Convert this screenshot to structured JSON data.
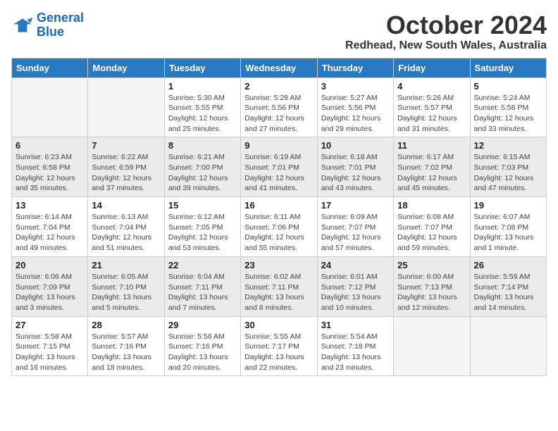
{
  "header": {
    "logo_line1": "General",
    "logo_line2": "Blue",
    "title": "October 2024",
    "location": "Redhead, New South Wales, Australia"
  },
  "weekdays": [
    "Sunday",
    "Monday",
    "Tuesday",
    "Wednesday",
    "Thursday",
    "Friday",
    "Saturday"
  ],
  "weeks": [
    [
      {
        "day": "",
        "sunrise": "",
        "sunset": "",
        "daylight": "",
        "empty": true
      },
      {
        "day": "",
        "sunrise": "",
        "sunset": "",
        "daylight": "",
        "empty": true
      },
      {
        "day": "1",
        "sunrise": "Sunrise: 5:30 AM",
        "sunset": "Sunset: 5:55 PM",
        "daylight": "Daylight: 12 hours and 25 minutes."
      },
      {
        "day": "2",
        "sunrise": "Sunrise: 5:28 AM",
        "sunset": "Sunset: 5:56 PM",
        "daylight": "Daylight: 12 hours and 27 minutes."
      },
      {
        "day": "3",
        "sunrise": "Sunrise: 5:27 AM",
        "sunset": "Sunset: 5:56 PM",
        "daylight": "Daylight: 12 hours and 29 minutes."
      },
      {
        "day": "4",
        "sunrise": "Sunrise: 5:26 AM",
        "sunset": "Sunset: 5:57 PM",
        "daylight": "Daylight: 12 hours and 31 minutes."
      },
      {
        "day": "5",
        "sunrise": "Sunrise: 5:24 AM",
        "sunset": "Sunset: 5:58 PM",
        "daylight": "Daylight: 12 hours and 33 minutes."
      }
    ],
    [
      {
        "day": "6",
        "sunrise": "Sunrise: 6:23 AM",
        "sunset": "Sunset: 6:58 PM",
        "daylight": "Daylight: 12 hours and 35 minutes."
      },
      {
        "day": "7",
        "sunrise": "Sunrise: 6:22 AM",
        "sunset": "Sunset: 6:59 PM",
        "daylight": "Daylight: 12 hours and 37 minutes."
      },
      {
        "day": "8",
        "sunrise": "Sunrise: 6:21 AM",
        "sunset": "Sunset: 7:00 PM",
        "daylight": "Daylight: 12 hours and 39 minutes."
      },
      {
        "day": "9",
        "sunrise": "Sunrise: 6:19 AM",
        "sunset": "Sunset: 7:01 PM",
        "daylight": "Daylight: 12 hours and 41 minutes."
      },
      {
        "day": "10",
        "sunrise": "Sunrise: 6:18 AM",
        "sunset": "Sunset: 7:01 PM",
        "daylight": "Daylight: 12 hours and 43 minutes."
      },
      {
        "day": "11",
        "sunrise": "Sunrise: 6:17 AM",
        "sunset": "Sunset: 7:02 PM",
        "daylight": "Daylight: 12 hours and 45 minutes."
      },
      {
        "day": "12",
        "sunrise": "Sunrise: 6:15 AM",
        "sunset": "Sunset: 7:03 PM",
        "daylight": "Daylight: 12 hours and 47 minutes."
      }
    ],
    [
      {
        "day": "13",
        "sunrise": "Sunrise: 6:14 AM",
        "sunset": "Sunset: 7:04 PM",
        "daylight": "Daylight: 12 hours and 49 minutes."
      },
      {
        "day": "14",
        "sunrise": "Sunrise: 6:13 AM",
        "sunset": "Sunset: 7:04 PM",
        "daylight": "Daylight: 12 hours and 51 minutes."
      },
      {
        "day": "15",
        "sunrise": "Sunrise: 6:12 AM",
        "sunset": "Sunset: 7:05 PM",
        "daylight": "Daylight: 12 hours and 53 minutes."
      },
      {
        "day": "16",
        "sunrise": "Sunrise: 6:11 AM",
        "sunset": "Sunset: 7:06 PM",
        "daylight": "Daylight: 12 hours and 55 minutes."
      },
      {
        "day": "17",
        "sunrise": "Sunrise: 6:09 AM",
        "sunset": "Sunset: 7:07 PM",
        "daylight": "Daylight: 12 hours and 57 minutes."
      },
      {
        "day": "18",
        "sunrise": "Sunrise: 6:08 AM",
        "sunset": "Sunset: 7:07 PM",
        "daylight": "Daylight: 12 hours and 59 minutes."
      },
      {
        "day": "19",
        "sunrise": "Sunrise: 6:07 AM",
        "sunset": "Sunset: 7:08 PM",
        "daylight": "Daylight: 13 hours and 1 minute."
      }
    ],
    [
      {
        "day": "20",
        "sunrise": "Sunrise: 6:06 AM",
        "sunset": "Sunset: 7:09 PM",
        "daylight": "Daylight: 13 hours and 3 minutes."
      },
      {
        "day": "21",
        "sunrise": "Sunrise: 6:05 AM",
        "sunset": "Sunset: 7:10 PM",
        "daylight": "Daylight: 13 hours and 5 minutes."
      },
      {
        "day": "22",
        "sunrise": "Sunrise: 6:04 AM",
        "sunset": "Sunset: 7:11 PM",
        "daylight": "Daylight: 13 hours and 7 minutes."
      },
      {
        "day": "23",
        "sunrise": "Sunrise: 6:02 AM",
        "sunset": "Sunset: 7:11 PM",
        "daylight": "Daylight: 13 hours and 8 minutes."
      },
      {
        "day": "24",
        "sunrise": "Sunrise: 6:01 AM",
        "sunset": "Sunset: 7:12 PM",
        "daylight": "Daylight: 13 hours and 10 minutes."
      },
      {
        "day": "25",
        "sunrise": "Sunrise: 6:00 AM",
        "sunset": "Sunset: 7:13 PM",
        "daylight": "Daylight: 13 hours and 12 minutes."
      },
      {
        "day": "26",
        "sunrise": "Sunrise: 5:59 AM",
        "sunset": "Sunset: 7:14 PM",
        "daylight": "Daylight: 13 hours and 14 minutes."
      }
    ],
    [
      {
        "day": "27",
        "sunrise": "Sunrise: 5:58 AM",
        "sunset": "Sunset: 7:15 PM",
        "daylight": "Daylight: 13 hours and 16 minutes."
      },
      {
        "day": "28",
        "sunrise": "Sunrise: 5:57 AM",
        "sunset": "Sunset: 7:16 PM",
        "daylight": "Daylight: 13 hours and 18 minutes."
      },
      {
        "day": "29",
        "sunrise": "Sunrise: 5:56 AM",
        "sunset": "Sunset: 7:16 PM",
        "daylight": "Daylight: 13 hours and 20 minutes."
      },
      {
        "day": "30",
        "sunrise": "Sunrise: 5:55 AM",
        "sunset": "Sunset: 7:17 PM",
        "daylight": "Daylight: 13 hours and 22 minutes."
      },
      {
        "day": "31",
        "sunrise": "Sunrise: 5:54 AM",
        "sunset": "Sunset: 7:18 PM",
        "daylight": "Daylight: 13 hours and 23 minutes."
      },
      {
        "day": "",
        "sunrise": "",
        "sunset": "",
        "daylight": "",
        "empty": true
      },
      {
        "day": "",
        "sunrise": "",
        "sunset": "",
        "daylight": "",
        "empty": true
      }
    ]
  ]
}
